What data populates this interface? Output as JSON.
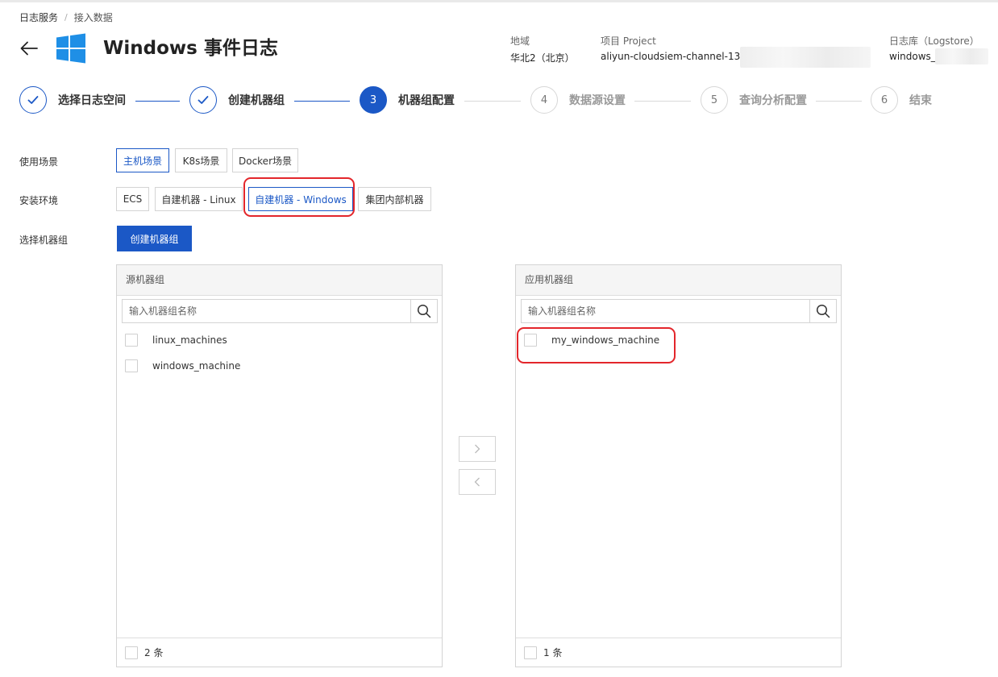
{
  "breadcrumb": {
    "root": "日志服务",
    "current": "接入数据"
  },
  "header": {
    "title": "Windows 事件日志",
    "region": {
      "label": "地域",
      "value": "华北2（北京）"
    },
    "project": {
      "label": "项目 Project",
      "value": "aliyun-cloudsiem-channel-135"
    },
    "logstore": {
      "label": "日志库（Logstore）",
      "value": "windows_"
    }
  },
  "steps": [
    {
      "label": "选择日志空间",
      "state": "done"
    },
    {
      "label": "创建机器组",
      "state": "done"
    },
    {
      "num": "3",
      "label": "机器组配置",
      "state": "active"
    },
    {
      "num": "4",
      "label": "数据源设置",
      "state": "pending"
    },
    {
      "num": "5",
      "label": "查询分析配置",
      "state": "pending"
    },
    {
      "num": "6",
      "label": "结束",
      "state": "pending"
    }
  ],
  "form": {
    "scenario": {
      "label": "使用场景",
      "options": [
        "主机场景",
        "K8s场景",
        "Docker场景"
      ],
      "selected": "主机场景"
    },
    "environment": {
      "label": "安装环境",
      "options": [
        "ECS",
        "自建机器 - Linux",
        "自建机器 - Windows",
        "集团内部机器"
      ],
      "selected": "自建机器 - Windows"
    },
    "machine_group": {
      "label": "选择机器组",
      "create_button": "创建机器组"
    }
  },
  "source_panel": {
    "title": "源机器组",
    "search_placeholder": "输入机器组名称",
    "items": [
      "linux_machines",
      "windows_machine"
    ],
    "footer": "2 条"
  },
  "target_panel": {
    "title": "应用机器组",
    "search_placeholder": "输入机器组名称",
    "items": [
      "my_windows_machine"
    ],
    "footer": "1 条"
  },
  "colors": {
    "primary": "#1b58c6",
    "highlight": "#e3262b",
    "windows_logo": "#1f8fe6"
  },
  "icons": {
    "back": "arrow-left-icon",
    "logo": "windows-logo-icon",
    "search": "search-icon",
    "check": "check-icon",
    "move_right": "chevron-right-icon",
    "move_left": "chevron-left-icon"
  }
}
